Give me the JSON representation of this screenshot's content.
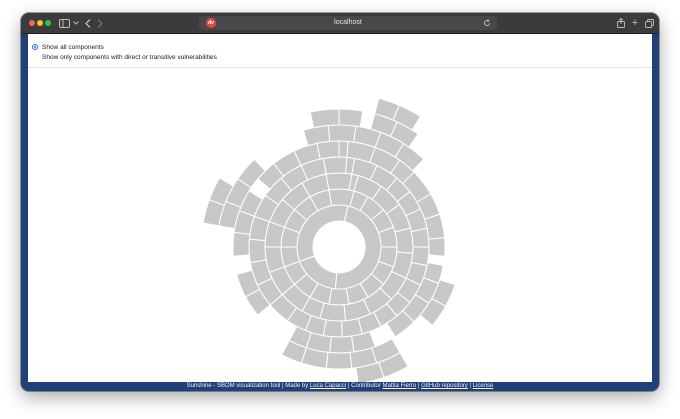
{
  "browser": {
    "url": "localhost"
  },
  "options": {
    "show_all": "Show all components",
    "show_vulnerable": "Show only components with direct or transitive vulnerabilities",
    "selected": "show_all"
  },
  "footer": {
    "prefix": "Sunshine - SBOM visualization tool | Made by ",
    "author": "Luca Capacci",
    "contributor_prefix": " | Contributor ",
    "contributor": "Mattia Fierro",
    "sep1": " | ",
    "repo": "GitHub repository",
    "sep2": " | ",
    "license": "License"
  },
  "sunburst": {
    "fill": "#c8c8c8",
    "stroke": "#ffffff",
    "rings": [
      {
        "level": 1,
        "segments": [
          [
            -78,
            95
          ],
          [
            95,
            160
          ],
          [
            160,
            282
          ]
        ]
      },
      {
        "level": 2,
        "segments": [
          [
            -75,
            -60
          ],
          [
            -60,
            -40
          ],
          [
            -40,
            -20
          ],
          [
            -20,
            0
          ],
          [
            0,
            20
          ],
          [
            20,
            40
          ],
          [
            40,
            60
          ],
          [
            60,
            80
          ],
          [
            80,
            100
          ],
          [
            100,
            120
          ],
          [
            120,
            140
          ],
          [
            140,
            160
          ],
          [
            160,
            180
          ],
          [
            180,
            200
          ],
          [
            200,
            220
          ],
          [
            220,
            240
          ],
          [
            240,
            260
          ],
          [
            260,
            285
          ]
        ]
      },
      {
        "level": 3,
        "segments": [
          [
            -95,
            -75
          ],
          [
            -75,
            -55
          ],
          [
            -55,
            -35
          ],
          [
            -35,
            -15
          ],
          [
            -15,
            5
          ],
          [
            5,
            25
          ],
          [
            25,
            45
          ],
          [
            45,
            65
          ],
          [
            65,
            85
          ],
          [
            85,
            105
          ],
          [
            105,
            120
          ],
          [
            120,
            140
          ],
          [
            140,
            160
          ],
          [
            160,
            180
          ],
          [
            180,
            200
          ],
          [
            200,
            220
          ],
          [
            220,
            240
          ],
          [
            240,
            260
          ],
          [
            260,
            280
          ]
        ]
      },
      {
        "level": 4,
        "segments": [
          [
            -95,
            -80
          ],
          [
            -80,
            -65
          ],
          [
            -65,
            -50
          ],
          [
            -50,
            -38
          ],
          [
            -38,
            -25
          ],
          [
            -25,
            -12
          ],
          [
            -12,
            0
          ],
          [
            0,
            12
          ],
          [
            12,
            25
          ],
          [
            25,
            38
          ],
          [
            38,
            50
          ],
          [
            50,
            62
          ],
          [
            62,
            75
          ],
          [
            75,
            88
          ],
          [
            88,
            100
          ],
          [
            100,
            112
          ],
          [
            112,
            125
          ],
          [
            125,
            140
          ],
          [
            140,
            155
          ],
          [
            155,
            170
          ],
          [
            170,
            185
          ],
          [
            185,
            200
          ],
          [
            200,
            215
          ],
          [
            215,
            230
          ],
          [
            230,
            245
          ],
          [
            245,
            260
          ],
          [
            260,
            275
          ]
        ]
      },
      {
        "level": 5,
        "segments": [
          [
            -100,
            -85
          ],
          [
            -85,
            -70
          ],
          [
            -70,
            -55
          ],
          [
            -55,
            -40
          ],
          [
            -45,
            -30
          ],
          [
            -30,
            -18
          ],
          [
            -18,
            -5
          ],
          [
            -5,
            5
          ],
          [
            10,
            20
          ],
          [
            20,
            32
          ],
          [
            32,
            45
          ],
          [
            45,
            58
          ],
          [
            70,
            82
          ],
          [
            82,
            95
          ],
          [
            95,
            108
          ],
          [
            108,
            118
          ],
          [
            140,
            152
          ],
          [
            152,
            165
          ],
          [
            175,
            188
          ],
          [
            188,
            200
          ],
          [
            200,
            212
          ],
          [
            220,
            232
          ],
          [
            232,
            245
          ],
          [
            245,
            258
          ],
          [
            258,
            270
          ]
        ]
      },
      {
        "level": 6,
        "segments": [
          [
            -107,
            -95
          ],
          [
            -95,
            -82
          ],
          [
            -82,
            -70
          ],
          [
            -70,
            -58
          ],
          [
            -58,
            -46
          ],
          [
            18,
            29
          ],
          [
            29,
            40
          ],
          [
            60,
            72
          ],
          [
            72,
            84
          ],
          [
            84,
            96
          ],
          [
            96,
            108
          ],
          [
            108,
            118
          ],
          [
            190,
            202
          ],
          [
            202,
            214
          ],
          [
            214,
            226
          ]
        ]
      },
      {
        "level": 7,
        "segments": [
          [
            -102,
            -90
          ],
          [
            -90,
            -80
          ],
          [
            -75,
            -65
          ],
          [
            -65,
            -55
          ],
          [
            60,
            71
          ],
          [
            71,
            82
          ],
          [
            190,
            200
          ],
          [
            200,
            210
          ]
        ]
      },
      {
        "level": 8,
        "segments": [
          [
            -67,
            -58
          ],
          [
            -75,
            -67
          ]
        ]
      }
    ]
  }
}
